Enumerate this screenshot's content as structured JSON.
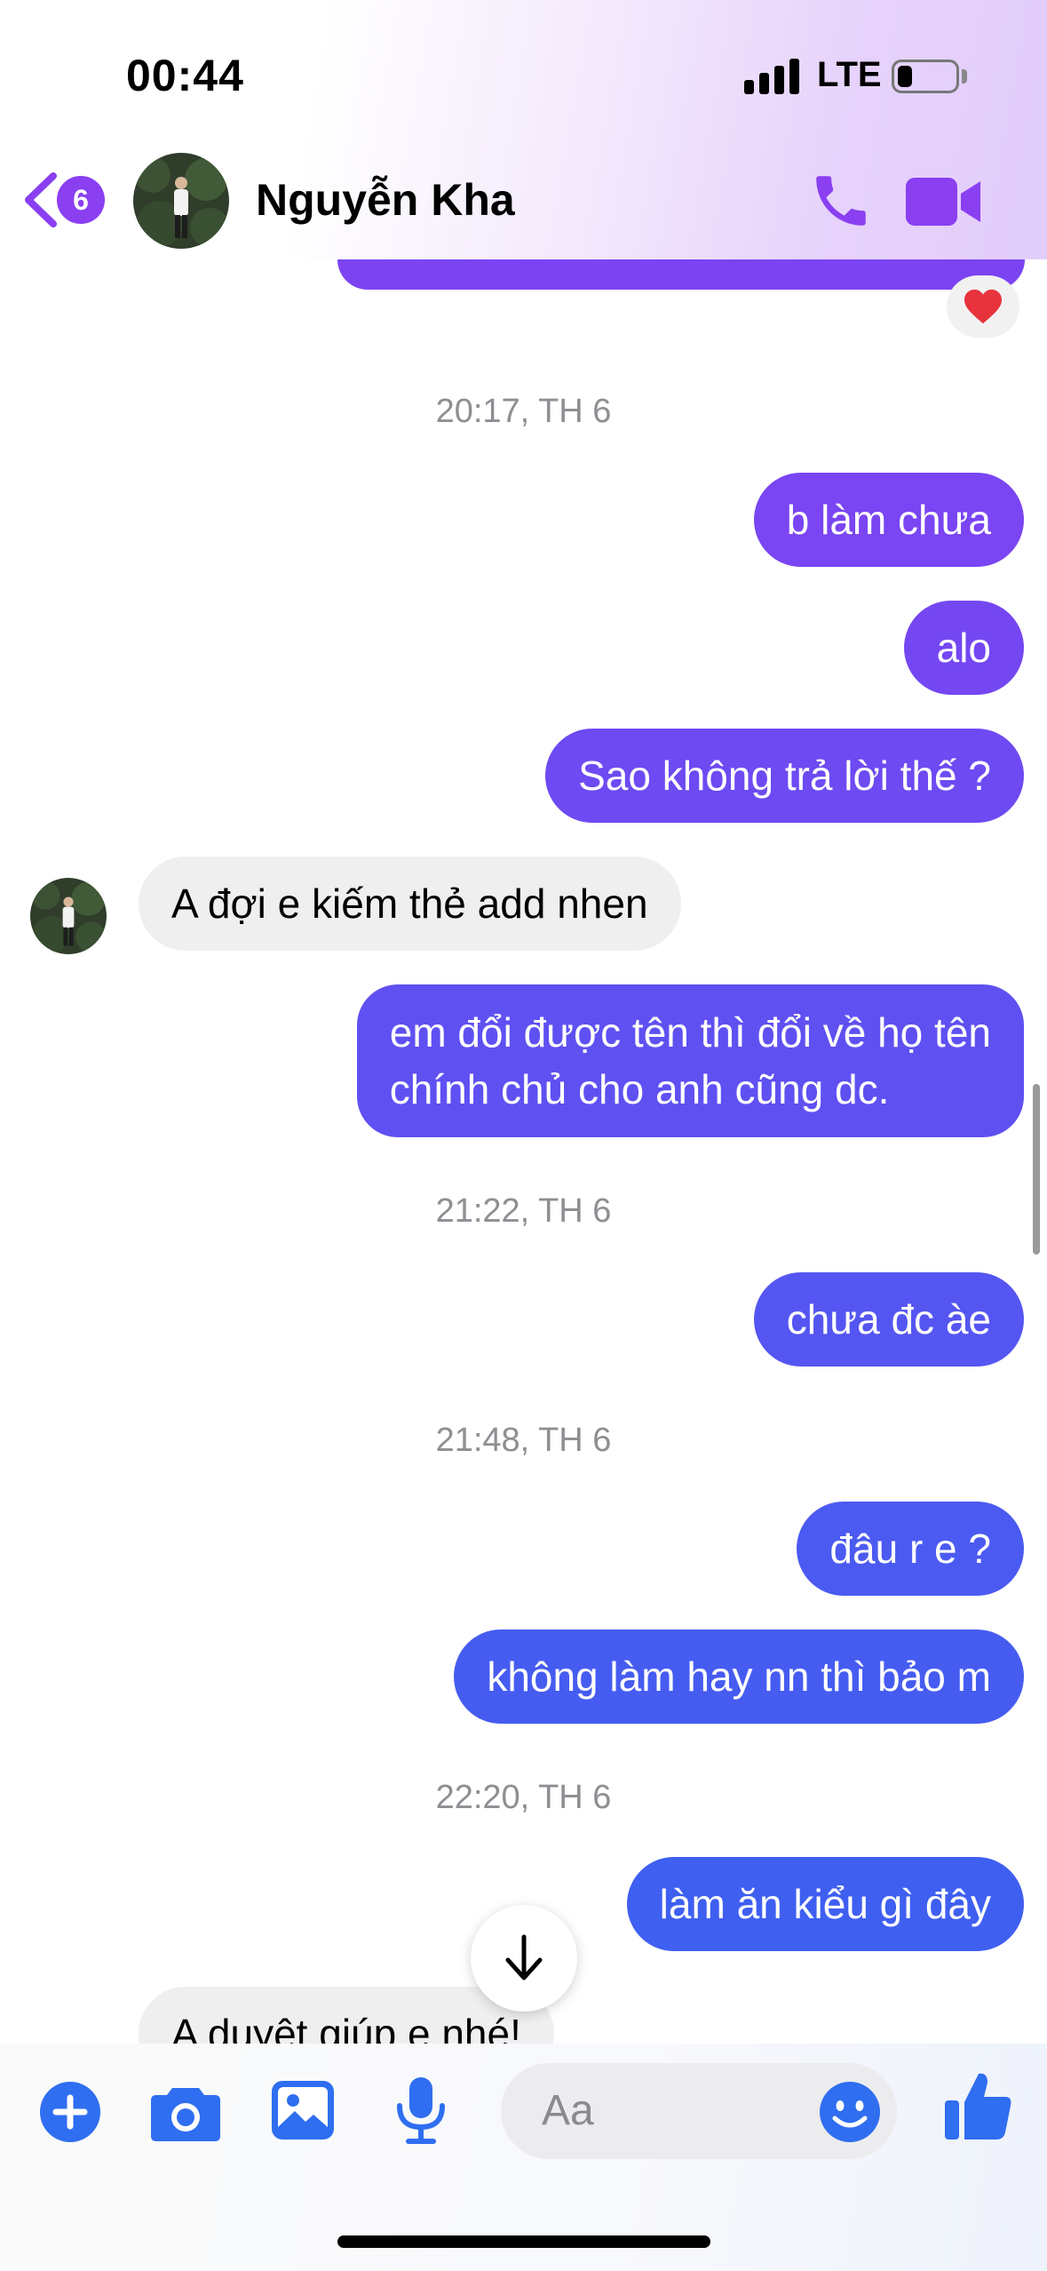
{
  "status_bar": {
    "time": "00:44",
    "network": "LTE"
  },
  "header": {
    "back_badge": "6",
    "contact_name": "Nguyễn Kha"
  },
  "reaction_emoji": "❤️",
  "messages": [
    {
      "type": "timestamp",
      "text": "20:17, TH 6"
    },
    {
      "type": "outgoing",
      "text": "b làm chưa"
    },
    {
      "type": "outgoing",
      "text": "alo"
    },
    {
      "type": "outgoing",
      "text": "Sao không trả lời thế ?"
    },
    {
      "type": "incoming",
      "text": "A đợi e kiếm thẻ add nhen"
    },
    {
      "type": "outgoing",
      "line1": "em đổi được tên thì đổi về họ tên",
      "line2": "chính chủ cho anh cũng dc."
    },
    {
      "type": "timestamp",
      "text": "21:22, TH 6"
    },
    {
      "type": "outgoing",
      "text": "chưa đc àe"
    },
    {
      "type": "timestamp",
      "text": "21:48, TH 6"
    },
    {
      "type": "outgoing",
      "text": "đâu r e ?"
    },
    {
      "type": "outgoing",
      "text": "không làm hay nn thì bảo m"
    },
    {
      "type": "timestamp",
      "text": "22:20, TH 6"
    },
    {
      "type": "outgoing",
      "text": "làm ăn kiểu gì đây"
    },
    {
      "type": "incoming",
      "text": "A duyệt giúp e nhé!"
    }
  ],
  "composer": {
    "placeholder": "Aa"
  },
  "colors": {
    "accent_purple": "#8a3ff1",
    "bubble_purple": "#7a45f2",
    "bubble_indigo": "#5b54f2",
    "bubble_blue": "#3e5ff1",
    "composer_blue": "#2f6ef0"
  }
}
